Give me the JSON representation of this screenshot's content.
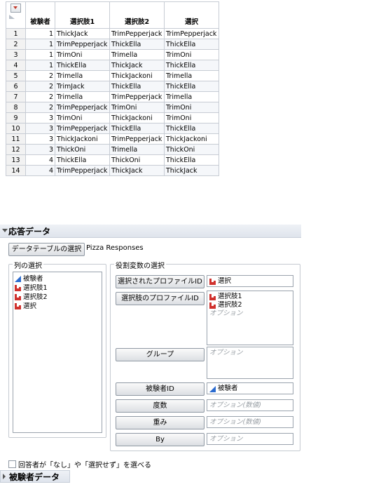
{
  "table": {
    "columns": [
      "被験者",
      "選択肢1",
      "選択肢2",
      "選択"
    ],
    "rows": [
      [
        1,
        1,
        "ThickJack",
        "TrimPepperjack",
        "TrimPepperjack"
      ],
      [
        2,
        1,
        "TrimPepperjack",
        "ThickElla",
        "ThickElla"
      ],
      [
        3,
        1,
        "TrimOni",
        "Trimella",
        "TrimOni"
      ],
      [
        4,
        1,
        "ThickElla",
        "ThickJack",
        "ThickElla"
      ],
      [
        5,
        2,
        "Trimella",
        "ThickJackoni",
        "Trimella"
      ],
      [
        6,
        2,
        "TrimJack",
        "ThickElla",
        "ThickElla"
      ],
      [
        7,
        2,
        "Trimella",
        "TrimPepperjack",
        "Trimella"
      ],
      [
        8,
        2,
        "TrimPepperjack",
        "TrimOni",
        "TrimOni"
      ],
      [
        9,
        3,
        "TrimOni",
        "ThickJackoni",
        "TrimOni"
      ],
      [
        10,
        3,
        "TrimPepperjack",
        "ThickElla",
        "ThickElla"
      ],
      [
        11,
        3,
        "ThickJackoni",
        "TrimPepperjack",
        "ThickJackoni"
      ],
      [
        12,
        3,
        "ThickOni",
        "Trimella",
        "ThickOni"
      ],
      [
        13,
        4,
        "ThickElla",
        "ThickOni",
        "ThickElla"
      ],
      [
        14,
        4,
        "TrimPepperjack",
        "ThickJack",
        "ThickJack"
      ]
    ]
  },
  "panel": {
    "title": "応答データ",
    "select_table_button": "データテーブルの選択",
    "table_name": "Pizza Responses",
    "columns_group_label": "列の選択",
    "columns": [
      {
        "name": "被験者",
        "type": "continuous"
      },
      {
        "name": "選択肢1",
        "type": "nominal"
      },
      {
        "name": "選択肢2",
        "type": "nominal"
      },
      {
        "name": "選択",
        "type": "nominal"
      }
    ],
    "roles_group_label": "役割変数の選択",
    "roles": {
      "chosen_profile": {
        "button": "選択されたプロファイルID",
        "value": "選択"
      },
      "choice_profiles": {
        "button": "選択肢のプロファイルID",
        "values": [
          "選択肢1",
          "選択肢2"
        ],
        "placeholder": "オプション"
      },
      "grouping": {
        "button": "グループ",
        "placeholder": "オプション"
      },
      "subject_id": {
        "button": "被験者ID",
        "value": "被験者"
      },
      "freq": {
        "button": "度数",
        "placeholder": "オプション(数値)"
      },
      "weight": {
        "button": "重み",
        "placeholder": "オプション(数値)"
      },
      "by": {
        "button": "By",
        "placeholder": "オプション"
      }
    },
    "none_option_label": "回答者が「なし」や「選択せず」を選べる"
  },
  "next_section": {
    "title": "被験者データ"
  },
  "colors": {
    "continuous_icon": "#2a6bcf",
    "nominal_icon": "#d0312d",
    "header_bg": "#e4e9f0"
  }
}
